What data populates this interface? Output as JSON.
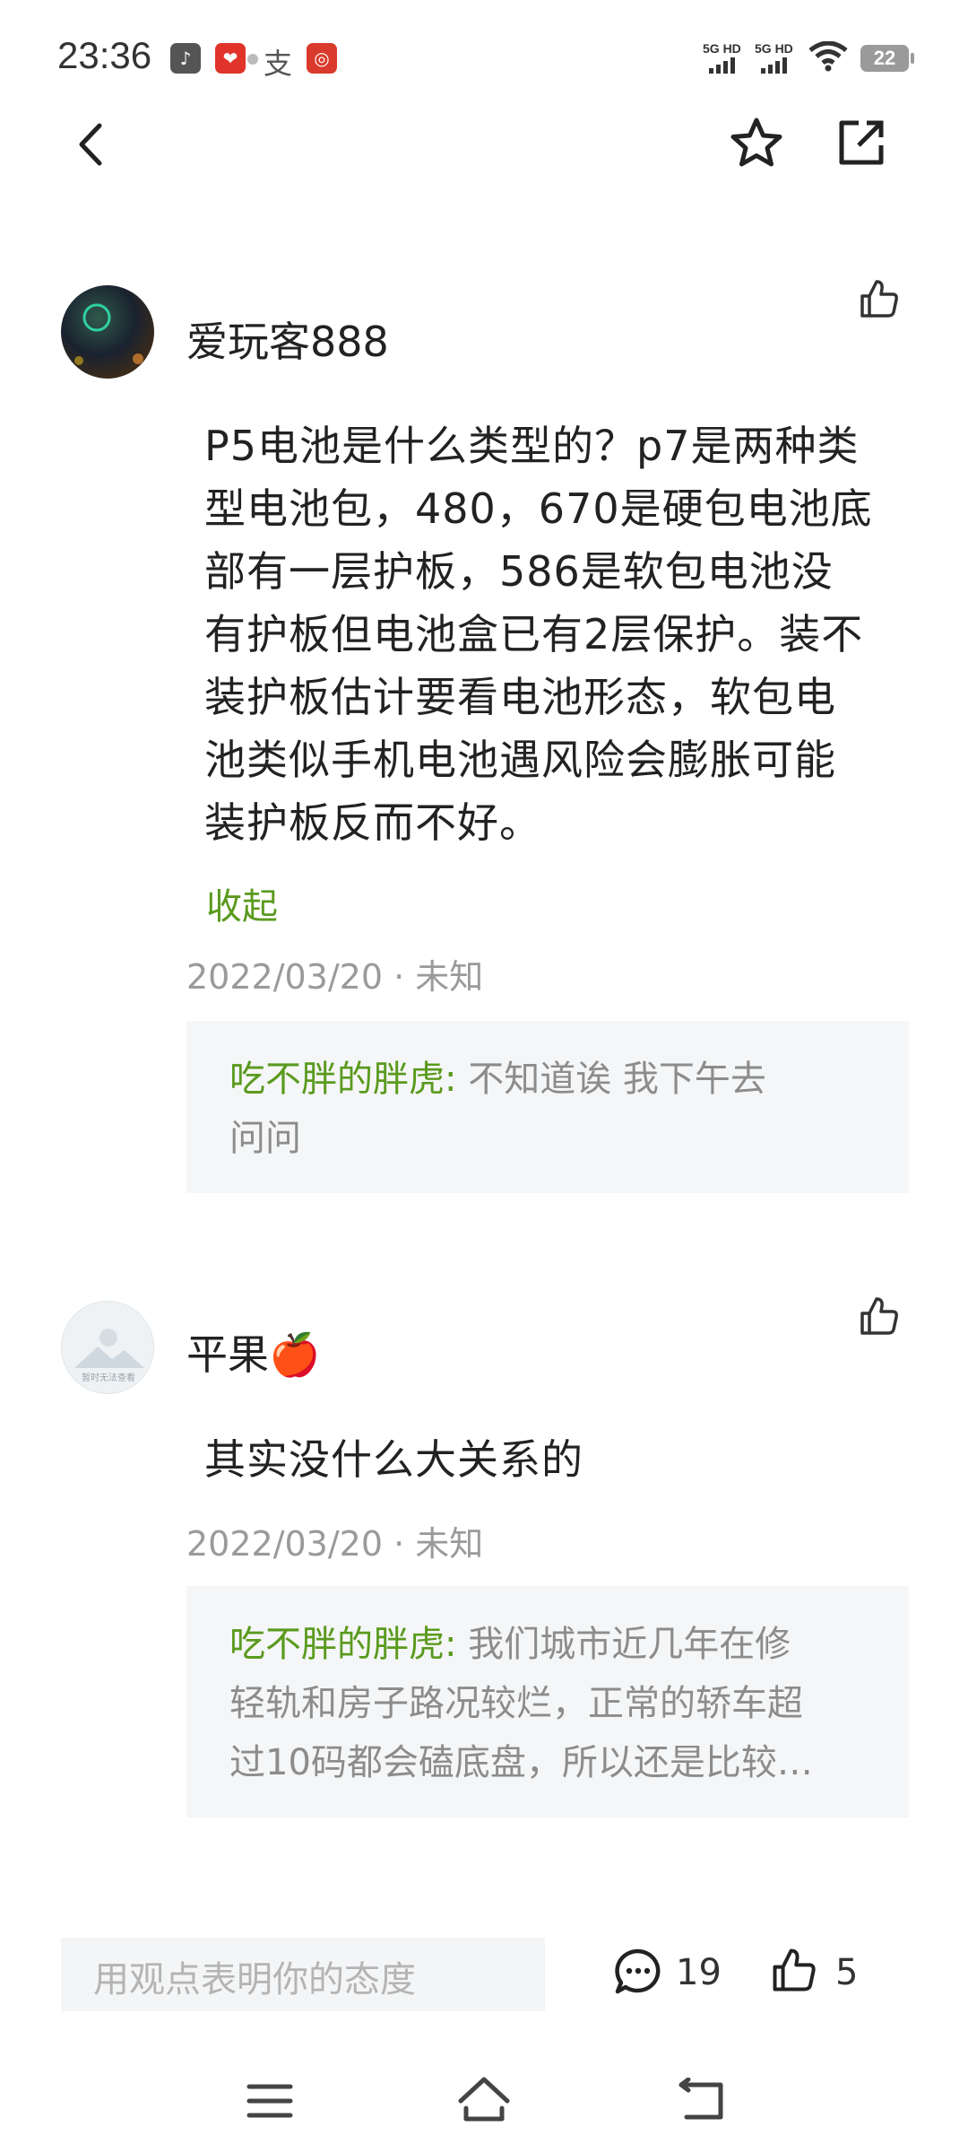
{
  "status_bar": {
    "time": "23:36",
    "network_1": "5G HD",
    "network_2": "5G HD",
    "battery": "22",
    "icons": [
      "tiktok-icon",
      "app-badge-icon",
      "alipay-icon",
      "bank-app-icon",
      "wifi-icon"
    ]
  },
  "header": {
    "back_icon": "chevron-left-icon",
    "star_icon": "star-outline-icon",
    "share_icon": "share-icon"
  },
  "comments": [
    {
      "username": "爱玩客888",
      "text_lines": [
        "P5电池是什么类型的？p7是两种类",
        "型电池包，480，670是硬包电池底",
        "部有一层护板，586是软包电池没",
        "有护板但电池盒已有2层保护。装不",
        "装护板估计要看电池形态，软包电",
        "池类似手机电池遇风险会膨胀可能",
        "装护板反而不好。"
      ],
      "collapse_label": "收起",
      "meta": "2022/03/20 · 未知",
      "reply": {
        "author": "吃不胖的胖虎:",
        "text_line1": " 不知道诶  我下午去",
        "text_line2": "问问"
      }
    },
    {
      "username": "平果🍎",
      "avatar_caption": "暂时无法查看",
      "text_lines": [
        "其实没什么大关系的"
      ],
      "meta": "2022/03/20 · 未知",
      "reply": {
        "author": "吃不胖的胖虎:",
        "text_line1": " 我们城市近几年在修",
        "text_line2": "轻轨和房子路况较烂，正常的轿车超",
        "text_line3": "过10码都会磕底盘，所以还是比较…"
      }
    }
  ],
  "bottom_bar": {
    "input_placeholder": "用观点表明你的态度",
    "comment_count": "19",
    "like_count": "5"
  },
  "nav_bar": {
    "menu_icon": "menu-icon",
    "home_icon": "home-icon",
    "back_icon": "back-icon"
  },
  "colors": {
    "accent_green": "#5a9a1e",
    "meta_gray": "#9a9a9a",
    "reply_bg": "#f5f6f7"
  }
}
